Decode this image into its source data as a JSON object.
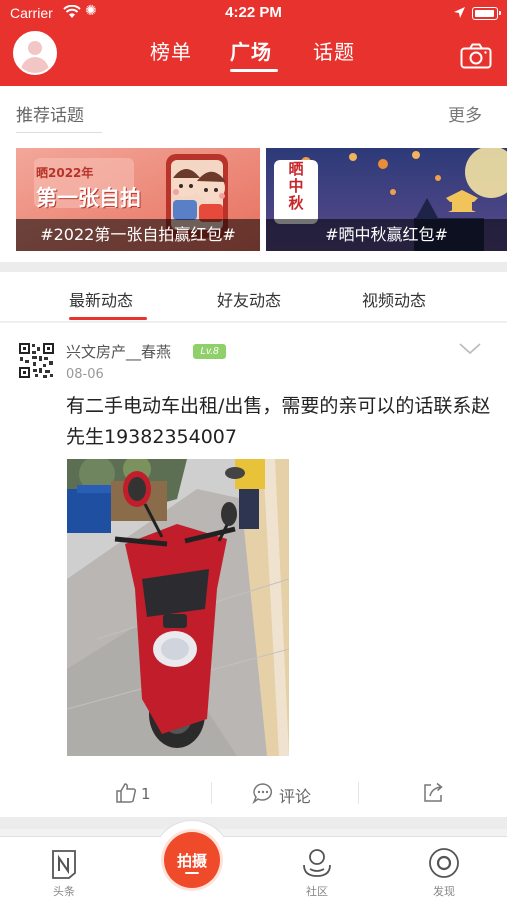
{
  "status_bar": {
    "carrier": "Carrier",
    "time": "4:22 PM"
  },
  "header": {
    "tabs": [
      {
        "label": "榜单",
        "active": false
      },
      {
        "label": "广场",
        "active": true
      },
      {
        "label": "话题",
        "active": false
      }
    ],
    "accent_color": "#e8322e"
  },
  "recommended": {
    "title": "推荐话题",
    "more_label": "更多",
    "topics": [
      {
        "label": "#2022第一张自拍赢红包#",
        "art_text_line1": "晒2022年",
        "art_text_line2": "第一张自拍"
      },
      {
        "label": "#晒中秋赢红包#",
        "art_text_vertical": [
          "晒",
          "中",
          "秋"
        ]
      }
    ]
  },
  "feed_tabs": [
    {
      "label": "最新动态",
      "active": true
    },
    {
      "label": "好友动态",
      "active": false
    },
    {
      "label": "视频动态",
      "active": false
    }
  ],
  "post": {
    "user": "兴文房产__春燕",
    "level_badge": "Lv.8",
    "date": "08-06",
    "text": "有二手电动车出租/出售，需要的亲可以的话联系赵先生19382354007",
    "likes": "1",
    "comment_label": "评论"
  },
  "bottom_tabs": [
    {
      "label": "头条",
      "icon": "headlines-icon"
    },
    {
      "label": "拍摄",
      "icon": "shoot-button"
    },
    {
      "label": "社区",
      "icon": "community-icon"
    },
    {
      "label": "发现",
      "icon": "discover-icon"
    }
  ]
}
